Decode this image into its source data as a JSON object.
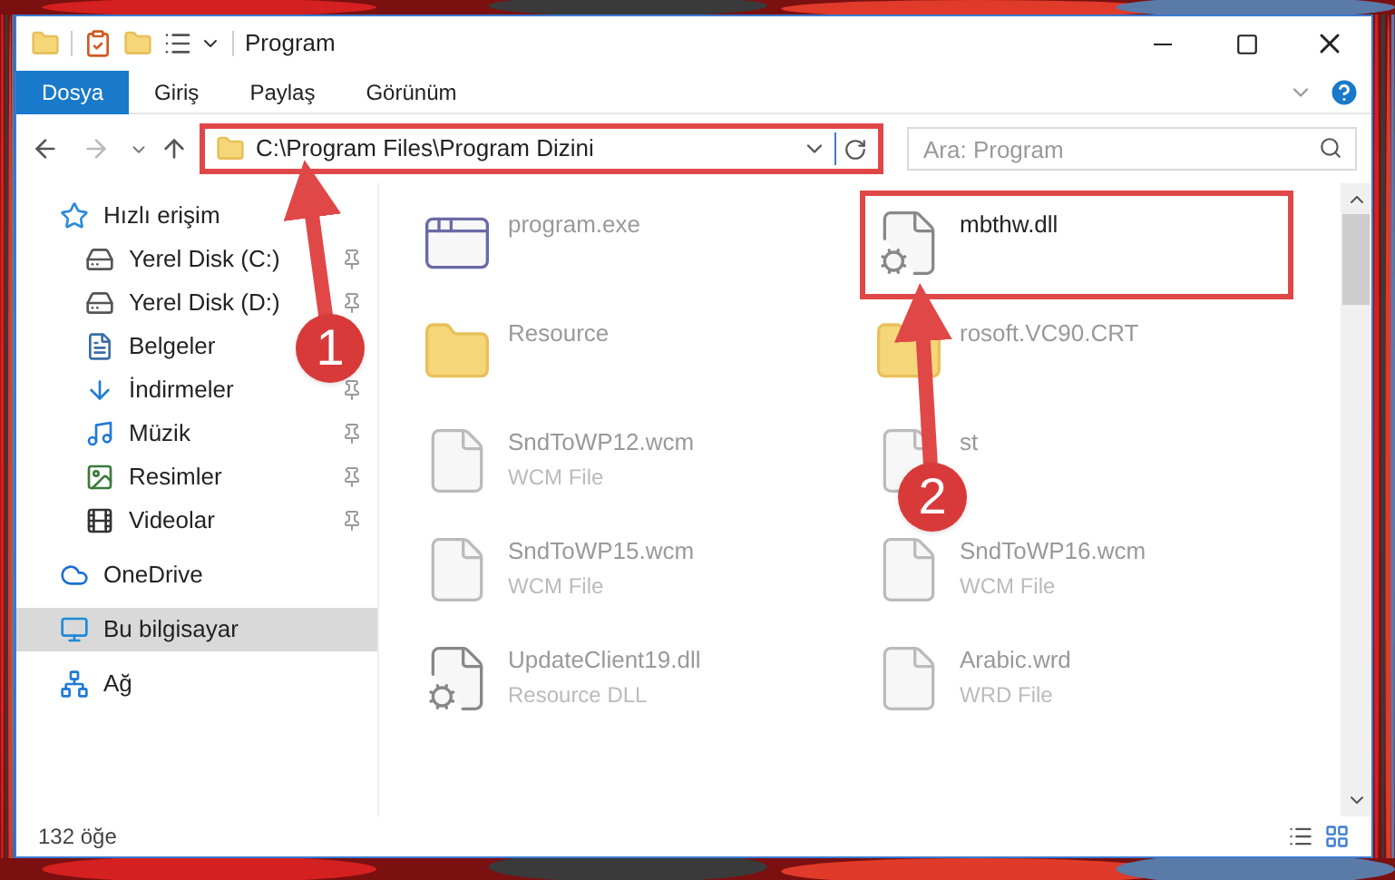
{
  "window": {
    "title": "Program"
  },
  "ribbon_tabs": [
    {
      "label": "Dosya",
      "selected": true
    },
    {
      "label": "Giriş",
      "selected": false
    },
    {
      "label": "Paylaş",
      "selected": false
    },
    {
      "label": "Görünüm",
      "selected": false
    }
  ],
  "address": {
    "path": "C:\\Program Files\\Program Dizini",
    "highlighted": true
  },
  "search": {
    "placeholder": "Ara: Program"
  },
  "sidebar": {
    "items": [
      {
        "label": "Hızlı erişim",
        "selected": false,
        "children": [
          {
            "label": "Yerel Disk (C:)",
            "pinned": true
          },
          {
            "label": "Yerel Disk (D:)",
            "pinned": true
          },
          {
            "label": "Belgeler"
          },
          {
            "label": "İndirmeler",
            "pinned": true
          },
          {
            "label": "Müzik",
            "pinned": true
          },
          {
            "label": "Resimler",
            "pinned": true
          },
          {
            "label": "Videolar",
            "pinned": true
          }
        ]
      },
      {
        "label": "OneDrive",
        "selected": false
      },
      {
        "label": "Bu bilgisayar",
        "selected": true
      },
      {
        "label": "Ağ",
        "selected": false
      }
    ]
  },
  "files": [
    {
      "name": "program.exe",
      "kind": "app",
      "highlighted": false
    },
    {
      "name": "mbthw.dll",
      "kind": "dll",
      "highlighted": true
    },
    {
      "name": "Resource",
      "kind": "folder",
      "highlighted": false
    },
    {
      "name": "rosoft.VC90.CRT",
      "kind": "folder",
      "highlighted": false
    },
    {
      "name": "SndToWP12.wcm",
      "type": "WCM File",
      "kind": "file",
      "highlighted": false
    },
    {
      "name": "st",
      "kind": "file",
      "highlighted": false
    },
    {
      "name": "SndToWP15.wcm",
      "type": "WCM File",
      "kind": "file",
      "highlighted": false
    },
    {
      "name": "SndToWP16.wcm",
      "type": "WCM File",
      "kind": "file",
      "highlighted": false
    },
    {
      "name": "UpdateClient19.dll",
      "type": "Resource DLL",
      "kind": "dll",
      "highlighted": false
    },
    {
      "name": "Arabic.wrd",
      "type": "WRD File",
      "kind": "file",
      "highlighted": false
    }
  ],
  "status_bar": {
    "count": "132 öğe"
  },
  "annotations": [
    {
      "label": "1"
    },
    {
      "label": "2"
    }
  ]
}
